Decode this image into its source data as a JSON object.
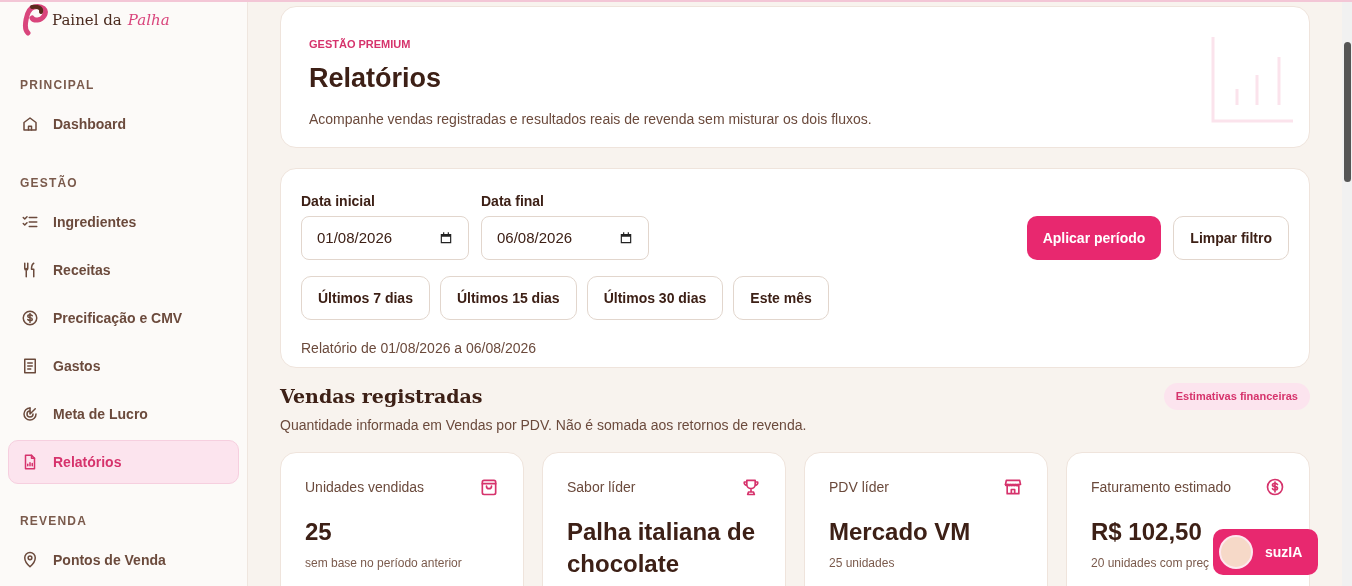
{
  "brand": {
    "name": "Painel da",
    "script": "Palha"
  },
  "sidebar": {
    "sections": [
      {
        "title": "PRINCIPAL",
        "items": [
          {
            "label": "Dashboard",
            "kind": "home",
            "selected": false
          }
        ]
      },
      {
        "title": "GESTÃO",
        "items": [
          {
            "label": "Ingredientes",
            "kind": "checklist",
            "selected": false
          },
          {
            "label": "Receitas",
            "kind": "utensils",
            "selected": false
          },
          {
            "label": "Precificação e CMV",
            "kind": "dollar",
            "selected": false
          },
          {
            "label": "Gastos",
            "kind": "receipt",
            "selected": false
          },
          {
            "label": "Meta de Lucro",
            "kind": "target",
            "selected": false
          },
          {
            "label": "Relatórios",
            "kind": "report",
            "selected": true
          }
        ]
      },
      {
        "title": "REVENDA",
        "items": [
          {
            "label": "Pontos de Venda",
            "kind": "pin",
            "selected": false
          }
        ]
      }
    ]
  },
  "header": {
    "eyebrow": "GESTÃO PREMIUM",
    "title": "Relatórios",
    "subtitle": "Acompanhe vendas registradas e resultados reais de revenda sem misturar os dois fluxos."
  },
  "filters": {
    "start_label": "Data inicial",
    "start_value": "01/08/2026",
    "end_label": "Data final",
    "end_value": "06/08/2026",
    "apply": "Aplicar período",
    "clear": "Limpar filtro",
    "presets": [
      "Últimos 7 dias",
      "Últimos 15 dias",
      "Últimos 30 dias",
      "Este mês"
    ],
    "summary": "Relatório de 01/08/2026 a 06/08/2026"
  },
  "sales": {
    "title": "Vendas registradas",
    "badge": "Estimativas financeiras",
    "description": "Quantidade informada em Vendas por PDV. Não é somada aos retornos de revenda.",
    "cards": [
      {
        "label": "Unidades vendidas",
        "kind": "bag",
        "value": "25",
        "note": "sem base no período anterior"
      },
      {
        "label": "Sabor líder",
        "kind": "trophy",
        "value": "Palha italiana de chocolate"
      },
      {
        "label": "PDV líder",
        "kind": "store",
        "value": "Mercado VM",
        "note": "25 unidades"
      },
      {
        "label": "Faturamento estimado",
        "kind": "dollar",
        "value": "R$ 102,50",
        "note": "20 unidades com preç"
      }
    ]
  },
  "assistant": {
    "label": "suzIA"
  }
}
